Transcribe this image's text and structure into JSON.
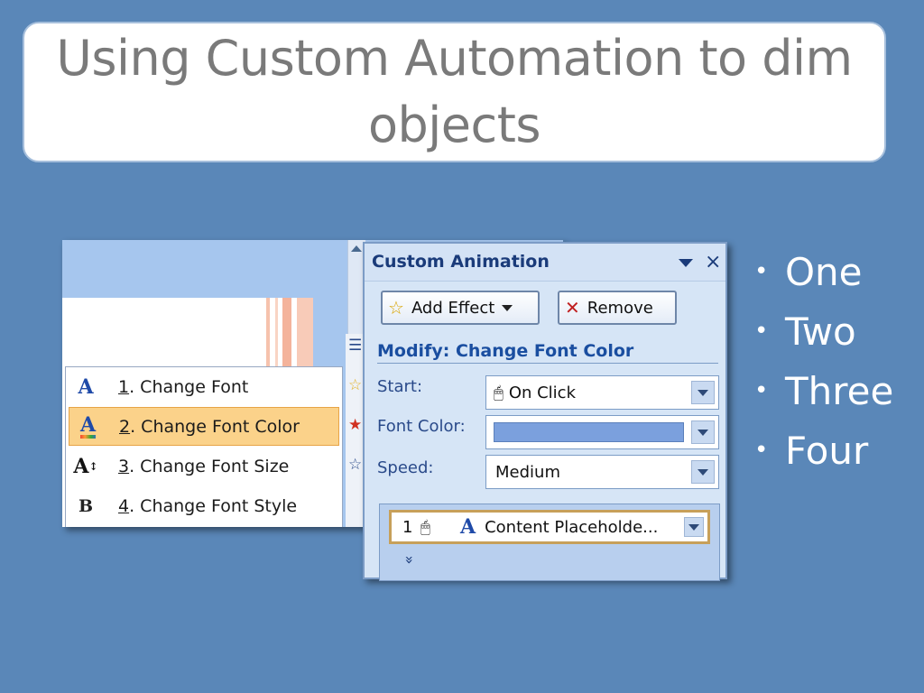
{
  "title": "Using Custom Automation to dim\nobjects",
  "menu": {
    "items": [
      {
        "num": "1",
        "label": ". Change Font",
        "icon": "font-a-icon",
        "glyph": "A",
        "selected": false
      },
      {
        "num": "2",
        "label": ". Change Font Color",
        "icon": "font-color-icon",
        "glyph": "A",
        "selected": true
      },
      {
        "num": "3",
        "label": ". Change Font Size",
        "icon": "font-size-icon",
        "glyph": "A",
        "selected": false
      },
      {
        "num": "4",
        "label": ". Change Font Style",
        "icon": "font-style-icon",
        "glyph": "B",
        "selected": false
      }
    ]
  },
  "panel": {
    "title": "Custom Animation",
    "close_glyph": "×",
    "add_effect_label": "Add Effect",
    "remove_label": "Remove",
    "modify_label": "Modify: Change Font Color",
    "start_label": "Start:",
    "start_value": "On Click",
    "font_color_label": "Font Color:",
    "font_color_value": "#7ba0dd",
    "speed_label": "Speed:",
    "speed_value": "Medium",
    "list_item": {
      "num": "1",
      "text": "Content Placeholde..."
    },
    "expand_glyph": "»"
  },
  "bullets": [
    "One",
    "Two",
    "Three",
    "Four"
  ],
  "colors": {
    "background": "#5a87b8",
    "title_text": "#7a7a7a",
    "selected_item": "#fbd28a"
  }
}
